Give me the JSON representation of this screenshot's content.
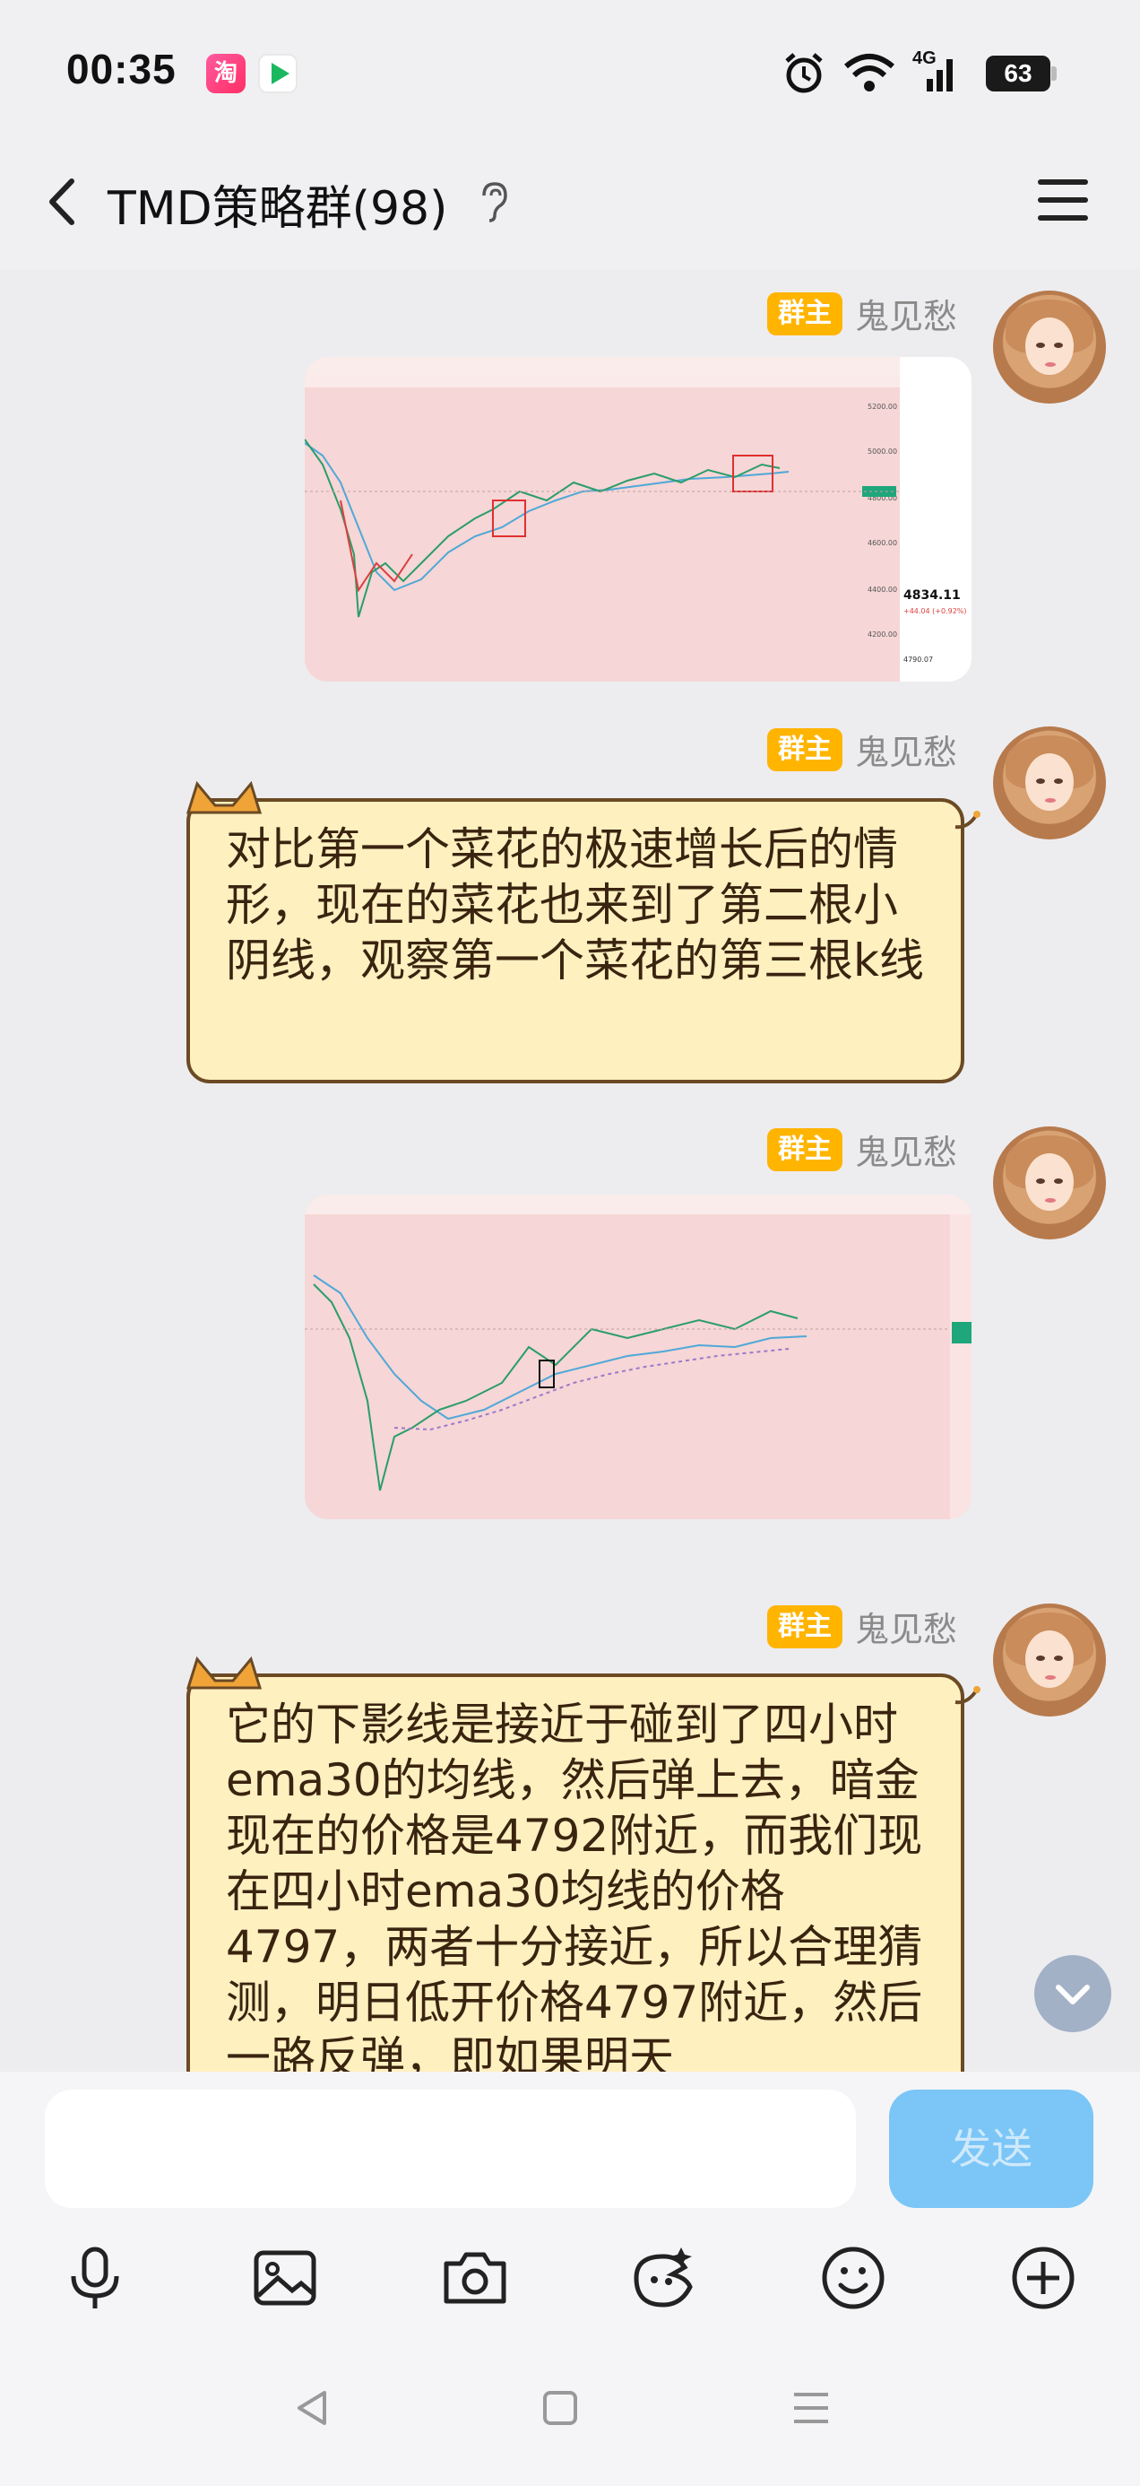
{
  "status_bar": {
    "time": "00:35",
    "battery": "63",
    "network": "4G",
    "app_icons": [
      "taobao-icon",
      "video-app-icon"
    ]
  },
  "header": {
    "title": "TMD策略群(98)"
  },
  "messages": [
    {
      "type": "image",
      "role_badge": "群主",
      "sender": "鬼见愁",
      "chart_labels": {
        "price_tag": "4834.11",
        "change": "+44.04 (+0.92%)",
        "low": "4790.07",
        "tick_5200": "5200.00",
        "tick_5000": "5000.00",
        "tick_4800": "4800.00",
        "tick_4600": "4600.00",
        "tick_4400": "4400.00",
        "tick_4200": "4200.00"
      }
    },
    {
      "type": "text",
      "role_badge": "群主",
      "sender": "鬼见愁",
      "text": "对比第一个菜花的极速增长后的情形，现在的菜花也来到了第二根小阴线，观察第一个菜花的第三根k线"
    },
    {
      "type": "image",
      "role_badge": "群主",
      "sender": "鬼见愁"
    },
    {
      "type": "text",
      "role_badge": "群主",
      "sender": "鬼见愁",
      "text": "它的下影线是接近于碰到了四小时ema30的均线，然后弹上去，暗金现在的价格是4792附近，而我们现在四小时ema30均线的价格4797，两者十分接近，所以合理猜测，明日低开价格4797附近，然后一路反弹，即如果明天"
    }
  ],
  "input": {
    "placeholder": "",
    "send_label": "发送"
  },
  "toolbar": [
    "microphone-icon",
    "image-icon",
    "camera-icon",
    "sticker-icon",
    "emoji-icon",
    "plus-icon"
  ],
  "colors": {
    "badge": "#ffb400",
    "bubble_bg": "#fff0c0",
    "bubble_border": "#6b4a24",
    "send_button": "#7bc6f7",
    "chart_bg": "#f6d6d6"
  }
}
